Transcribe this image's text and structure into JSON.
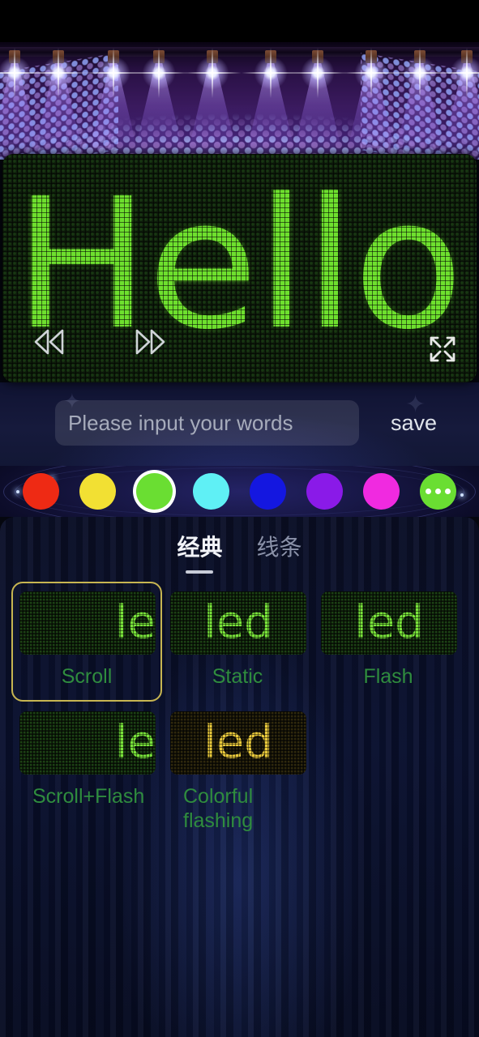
{
  "app": {
    "background_accent": "#2a1146",
    "panel_accent": "#c7b551"
  },
  "stage": {
    "name": "concert-stage-backdrop"
  },
  "led_display": {
    "text": "Hello",
    "text_color": "#6ee02e",
    "background_color": "#0e1c0b",
    "controls": {
      "prev_icon": "rewind-icon",
      "next_icon": "fast-forward-icon",
      "expand_icon": "expand-fullscreen-icon"
    }
  },
  "input_row": {
    "placeholder": "Please input your words",
    "value": "",
    "save_label": "save"
  },
  "colors": {
    "selected_index": 2,
    "swatches": [
      {
        "name": "red",
        "hex": "#ee2a14"
      },
      {
        "name": "yellow",
        "hex": "#f2e033"
      },
      {
        "name": "green",
        "hex": "#6ade32"
      },
      {
        "name": "cyan",
        "hex": "#5ff0f5"
      },
      {
        "name": "blue",
        "hex": "#1417e0"
      },
      {
        "name": "purple",
        "hex": "#8a1ae8"
      },
      {
        "name": "magenta",
        "hex": "#f02ae0"
      },
      {
        "name": "more",
        "hex": "#6ade32"
      }
    ],
    "more_label": "more-colors"
  },
  "tabs": [
    {
      "label": "经典",
      "active": true
    },
    {
      "label": "线条",
      "active": false
    }
  ],
  "effects": [
    {
      "label": "Scroll",
      "preview_text": "led",
      "preview_style": "offright",
      "led_color": "#79e33a",
      "screen": "green",
      "selected": true
    },
    {
      "label": "Static",
      "preview_text": "led",
      "preview_style": "center",
      "led_color": "#79e33a",
      "screen": "green",
      "selected": false
    },
    {
      "label": "Flash",
      "preview_text": "led",
      "preview_style": "center",
      "led_color": "#79e33a",
      "screen": "green",
      "selected": false
    },
    {
      "label": "Scroll+Flash",
      "preview_text": "led",
      "preview_style": "offright",
      "led_color": "#79e33a",
      "screen": "green",
      "selected": false
    },
    {
      "label": "Colorful flashing",
      "preview_text": "led",
      "preview_style": "center",
      "led_color": "#e8c93c",
      "screen": "dark",
      "selected": false
    }
  ]
}
